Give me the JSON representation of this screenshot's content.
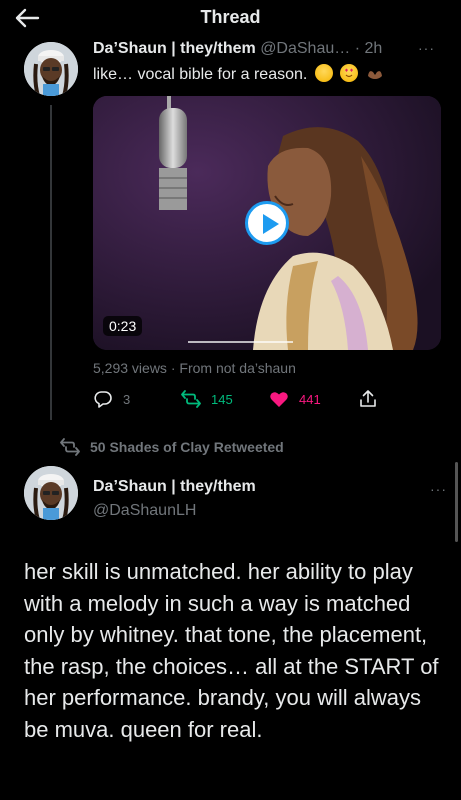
{
  "header": {
    "title": "Thread"
  },
  "thread_tweet": {
    "name": "Da’Shaun | they/them",
    "handle": "@DaShau…",
    "separator": "·",
    "time": "2h",
    "more": "···",
    "text": "like… vocal bible for a reason.",
    "media": {
      "duration": "0:23"
    },
    "views": "5,293 views",
    "views_sep": " · ",
    "source": "From not da’shaun",
    "replies": "3",
    "retweets": "145",
    "likes": "441"
  },
  "retweet_banner": {
    "text": "50 Shades of Clay Retweeted"
  },
  "main_tweet": {
    "name": "Da’Shaun | they/them",
    "handle": "@DaShaunLH",
    "more": "···",
    "text": "her skill is unmatched. her ability to play with a melody in such a way is matched only by whitney. that tone, the placement, the rasp, the choices… all at the START of her performance. brandy, you will always be muva. queen for real."
  },
  "colors": {
    "background": "#000000",
    "text": "#e7e9ea",
    "secondary": "#71767b",
    "retweet_green": "#00ba7c",
    "like_pink": "#f91880",
    "accent_blue": "#1d9bf0"
  },
  "icons": [
    "back-arrow-icon",
    "reply-icon",
    "retweet-icon",
    "heart-icon",
    "share-icon",
    "play-icon",
    "more-icon"
  ]
}
